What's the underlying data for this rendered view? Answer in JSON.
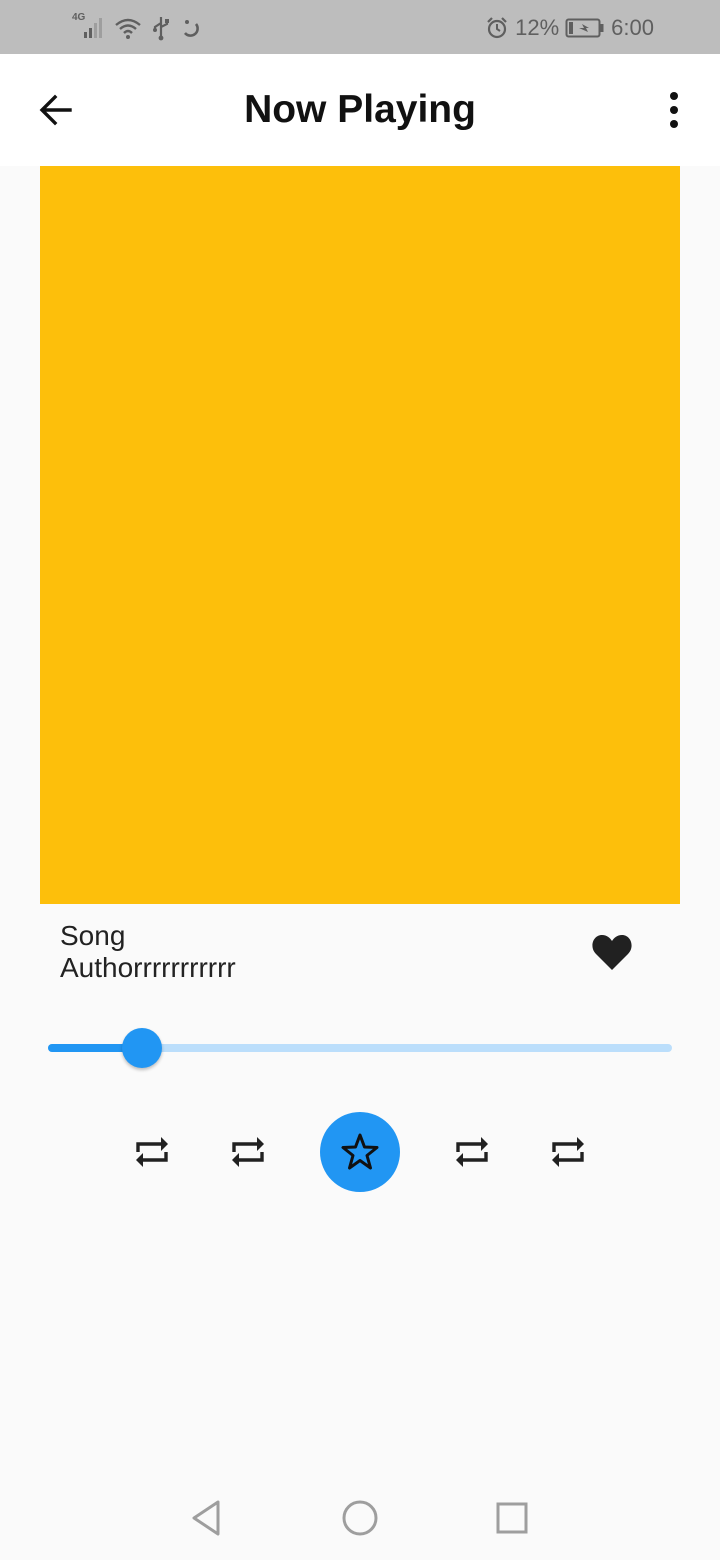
{
  "status_bar": {
    "network_label": "4G",
    "battery_percent": "12%",
    "time": "6:00",
    "icons": [
      "signal-icon",
      "wifi-icon",
      "usb-icon",
      "notification-icon",
      "alarm-icon",
      "battery-charging-icon"
    ]
  },
  "app_bar": {
    "title": "Now Playing",
    "back_icon": "arrow-back-icon",
    "menu_icon": "more-vert-icon"
  },
  "album_art": {
    "color": "#fdbf0b"
  },
  "track": {
    "title": "Song",
    "author": "Authorrrrrrrrrrr",
    "favorite_icon": "heart-icon"
  },
  "progress": {
    "value": 0.15
  },
  "controls": {
    "icons": [
      "repeat-icon",
      "repeat-icon",
      "star-icon",
      "repeat-icon",
      "repeat-icon"
    ],
    "accent": "#2196f3"
  },
  "nav_bar": {
    "icons": [
      "nav-back-icon",
      "nav-home-icon",
      "nav-recents-icon"
    ]
  }
}
